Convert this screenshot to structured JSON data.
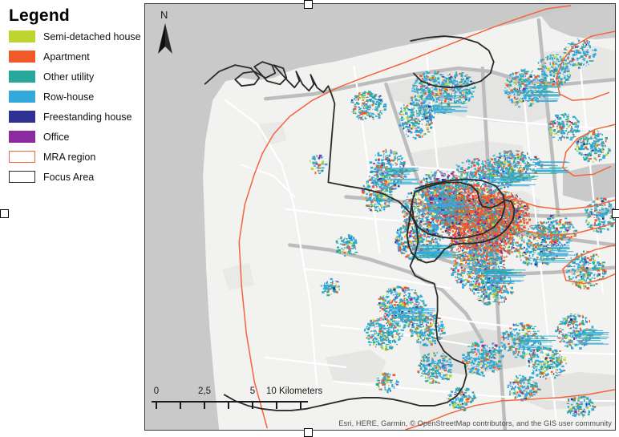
{
  "legend": {
    "title": "Legend",
    "items": [
      {
        "label": "Semi-detached house",
        "color": "#bdd52e",
        "style": "fill"
      },
      {
        "label": "Apartment",
        "color": "#f05a28",
        "style": "fill"
      },
      {
        "label": "Other utility",
        "color": "#2aa79b",
        "style": "fill"
      },
      {
        "label": "Row-house",
        "color": "#34a9dc",
        "style": "fill"
      },
      {
        "label": "Freestanding house",
        "color": "#2e3192",
        "style": "fill"
      },
      {
        "label": "Office",
        "color": "#8b2ba0",
        "style": "fill"
      },
      {
        "label": "MRA region",
        "color": "#f4643c",
        "style": "outline"
      },
      {
        "label": "Focus Area",
        "color": "#2b2b2b",
        "style": "outline"
      }
    ]
  },
  "map": {
    "north_arrow_label": "N",
    "scalebar": {
      "ticks": [
        "0",
        "2,5",
        "5"
      ],
      "unit_label": "10 Kilometers"
    },
    "attribution": "Esri, HERE, Garmin, © OpenStreetMap contributors, and the GIS user community",
    "colors": {
      "water": "#c9c9c9",
      "land": "#f2f2f0",
      "urban_grey": "#d9d9d9",
      "road_major": "#bfbfbf",
      "road_minor": "#ffffff",
      "mra_boundary": "#f4643c",
      "focus_boundary": "#2b2b2b"
    }
  }
}
